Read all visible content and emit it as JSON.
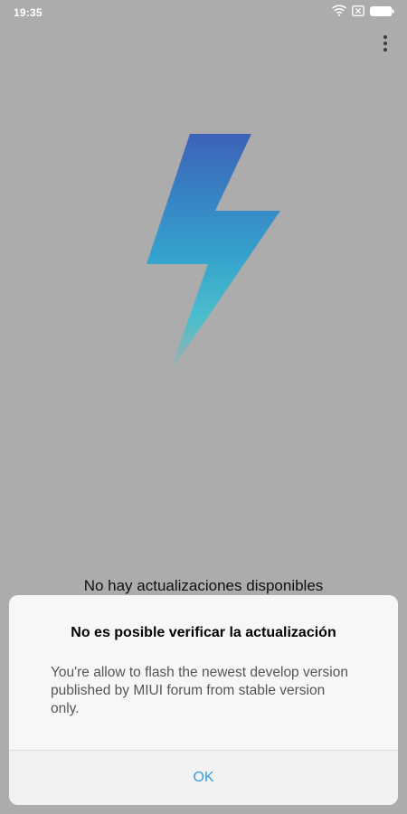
{
  "status_bar": {
    "time": "19:35",
    "icons": [
      "wifi-icon",
      "no-sim-icon",
      "battery-icon"
    ]
  },
  "toolbar": {
    "overflow_icon": "more-vertical-icon"
  },
  "hero": {
    "icon": "lightning-bolt-icon",
    "colors": {
      "top": "#3d62b9",
      "mid": "#33a1cc",
      "bottom": "#42c1cf"
    }
  },
  "main": {
    "status_message": "No hay actualizaciones disponibles"
  },
  "dialog": {
    "title": "No es posible verificar la actualización",
    "message": "You're allow to flash the newest develop version published by MIUI forum from stable version only.",
    "ok_label": "OK",
    "accent_color": "#2f9ee5"
  }
}
